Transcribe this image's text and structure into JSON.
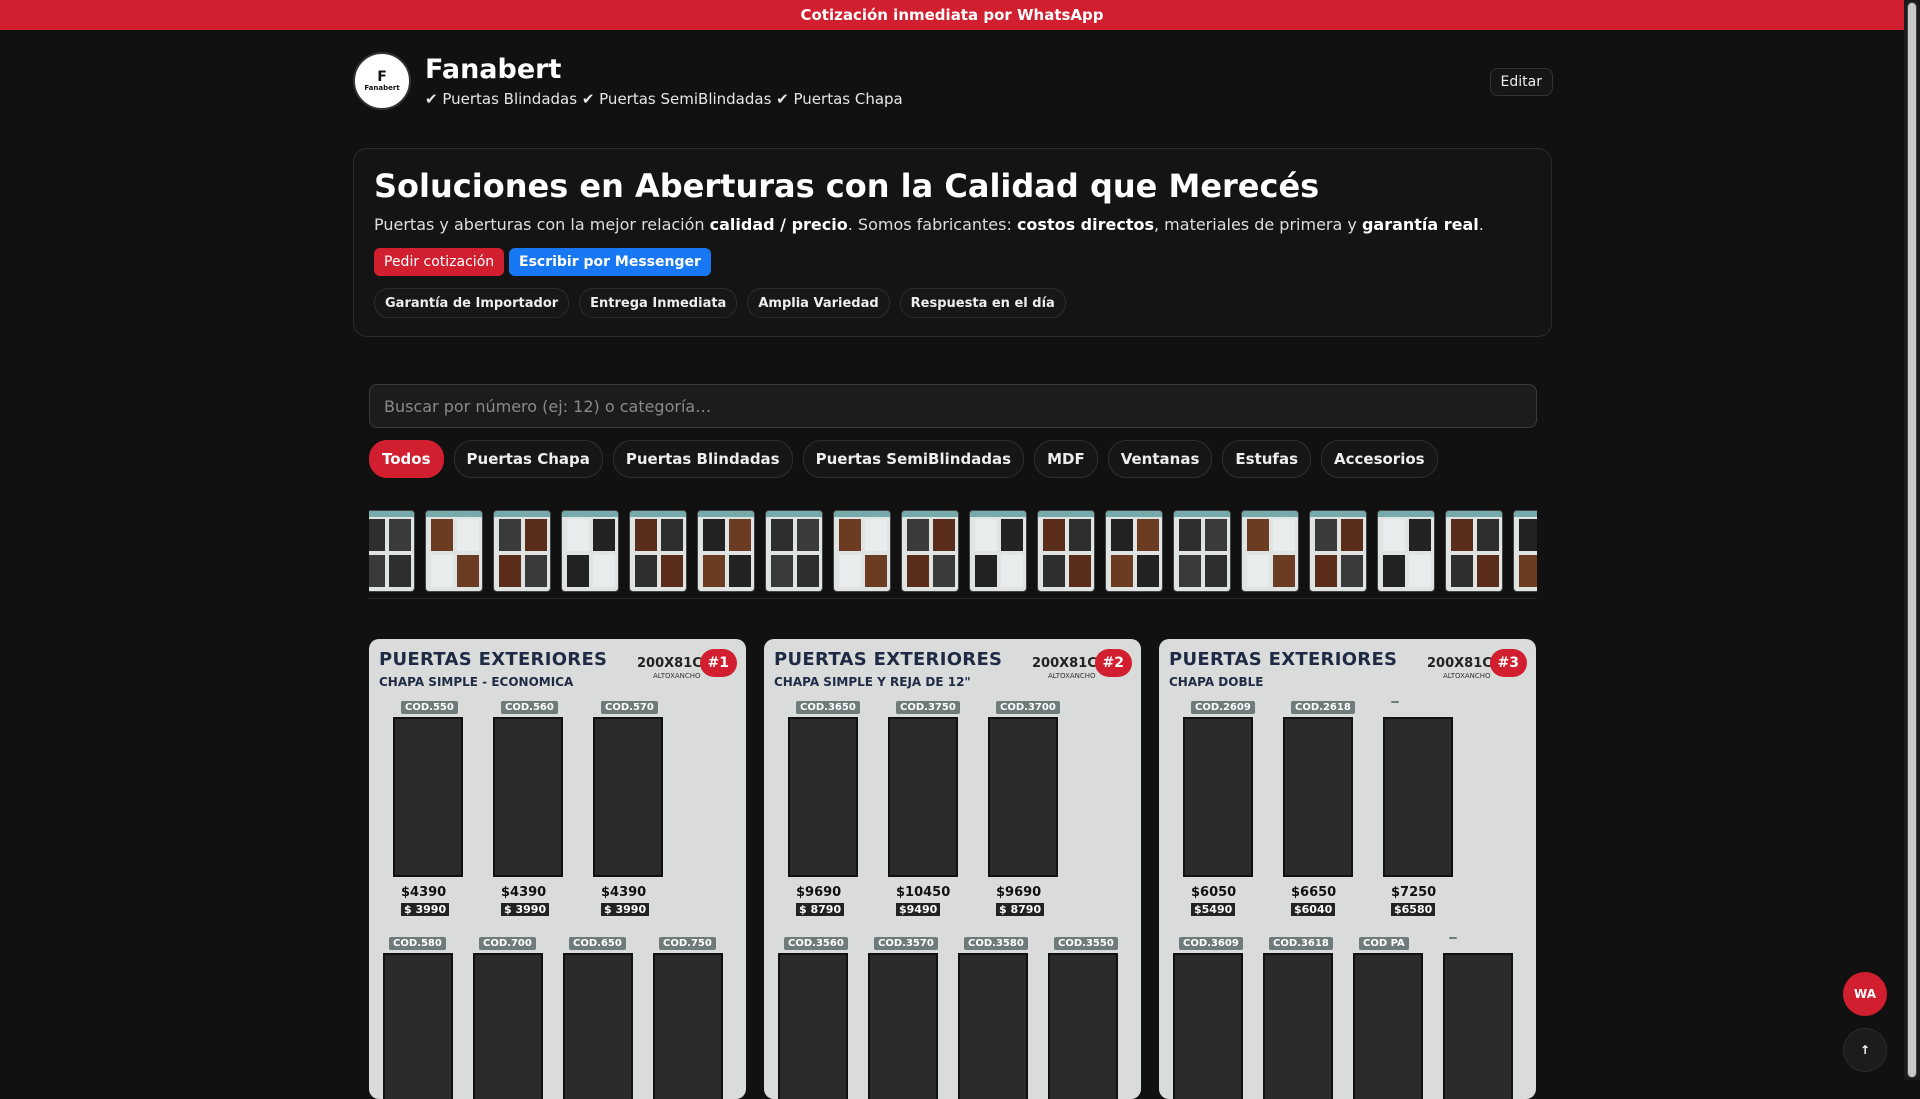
{
  "topbar": {
    "text": "Cotización inmediata por WhatsApp"
  },
  "header": {
    "logo_mark": "F",
    "logo_text": "Fanabert",
    "name": "Fanabert",
    "tagline": "✔ Puertas Blindadas ✔ Puertas SemiBlindadas ✔ Puertas Chapa",
    "edit_label": "Editar"
  },
  "hero": {
    "title": "Soluciones en Aberturas con la Calidad que Merecés",
    "desc_1": "Puertas y aberturas con la mejor relación ",
    "desc_b1": "calidad / precio",
    "desc_2": ". Somos fabricantes: ",
    "desc_b2": "costos directos",
    "desc_3": ", materiales de primera y ",
    "desc_b3": "garantía real",
    "desc_4": ".",
    "cta_quote": "Pedir cotización",
    "cta_messenger": "Escribir por Messenger",
    "badges": [
      "Garantía de Importador",
      "Entrega Inmediata",
      "Amplia Variedad",
      "Respuesta en el día"
    ]
  },
  "search": {
    "placeholder": "Buscar por número (ej: 12) o categoría…"
  },
  "filters": [
    "Todos",
    "Puertas Chapa",
    "Puertas Blindadas",
    "Puertas SemiBlindadas",
    "MDF",
    "Ventanas",
    "Estufas",
    "Accesorios"
  ],
  "cards": [
    {
      "title": "PUERTAS EXTERIORES",
      "subtitle": "CHAPA SIMPLE - ECONOMICA",
      "dims": "200X81CM",
      "dims_sub": "ALTOXANCHO",
      "num": "#1",
      "codes_top": [
        "COD.550",
        "COD.560",
        "COD.570"
      ],
      "prices": [
        "$4390",
        "$4390",
        "$4390"
      ],
      "prices_cash": [
        "$ 3990",
        "$ 3990",
        "$ 3990"
      ],
      "codes_bottom": [
        "COD.580",
        "COD.700",
        "COD.650",
        "COD.750"
      ]
    },
    {
      "title": "PUERTAS EXTERIORES",
      "subtitle": "CHAPA SIMPLE Y REJA DE 12\"",
      "dims": "200X81CM",
      "dims_sub": "ALTOXANCHO",
      "num": "#2",
      "codes_top": [
        "COD.3650",
        "COD.3750",
        "COD.3700"
      ],
      "prices": [
        "$9690",
        "$10450",
        "$9690"
      ],
      "prices_cash": [
        "$ 8790",
        "$9490",
        "$ 8790"
      ],
      "codes_bottom": [
        "COD.3560",
        "COD.3570",
        "COD.3580",
        "COD.3550"
      ]
    },
    {
      "title": "PUERTAS EXTERIORES",
      "subtitle": "CHAPA DOBLE",
      "dims": "200X81CM",
      "dims_sub": "ALTOXANCHO",
      "num": "#3",
      "codes_top": [
        "COD.2609",
        "COD.2618",
        ""
      ],
      "prices": [
        "$6050",
        "$6650",
        "$7250"
      ],
      "prices_cash": [
        "$5490",
        "$6040",
        "$6580"
      ],
      "codes_bottom": [
        "COD.3609",
        "COD.3618",
        "COD PA",
        ""
      ]
    }
  ],
  "fab": {
    "wa": "WA",
    "up": "↑"
  }
}
